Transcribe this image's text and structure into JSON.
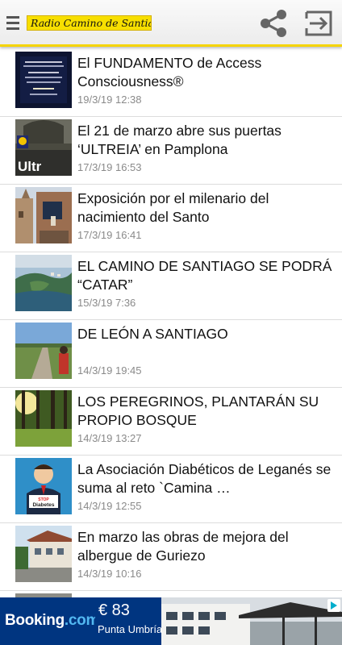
{
  "header": {
    "logo_text": "Radio Camino de Santiago",
    "menu_icon": "hamburger-menu-icon",
    "share_icon": "share-icon",
    "exit_icon": "exit-icon",
    "accent_color": "#f5d400"
  },
  "news": [
    {
      "title": "El FUNDAMENTO de Access Consciousness®",
      "date": "19/3/19 12:38",
      "thumb_icon": "event-poster-thumbnail"
    },
    {
      "title": "El 21 de marzo abre sus puertas ‘ULTREIA’ en Pamplona",
      "date": "17/3/19 16:53",
      "thumb_icon": "ultreia-shop-thumbnail"
    },
    {
      "title": "Exposición por el milenario del nacimiento del Santo",
      "date": "17/3/19 16:41",
      "thumb_icon": "old-town-street-thumbnail"
    },
    {
      "title": "EL CAMINO DE SANTIAGO SE PODRÁ “CATAR”",
      "date": "15/3/19 7:36",
      "thumb_icon": "coastal-city-thumbnail"
    },
    {
      "title": "DE LEÓN A SANTIAGO",
      "date": "14/3/19 19:45",
      "thumb_icon": "pilgrim-road-thumbnail"
    },
    {
      "title": "LOS PEREGRINOS, PLANTARÁN SU PROPIO BOSQUE",
      "date": "14/3/19 13:27",
      "thumb_icon": "forest-thumbnail"
    },
    {
      "title": "La Asociación Diabéticos de Leganés se suma al reto `Camina …",
      "date": "14/3/19 12:55",
      "thumb_icon": "stop-diabetes-thumbnail"
    },
    {
      "title": "En marzo las obras de mejora del albergue de Guriezo",
      "date": "14/3/19 10:16",
      "thumb_icon": "albergue-building-thumbnail"
    },
    {
      "title": "",
      "date": "",
      "thumb_icon": "partial-thumbnail"
    }
  ],
  "ad": {
    "brand": "Booking",
    "brand_suffix": ".com",
    "price": "€ 83",
    "location": "Punta Umbría",
    "close_icon": "ad-info-icon"
  }
}
